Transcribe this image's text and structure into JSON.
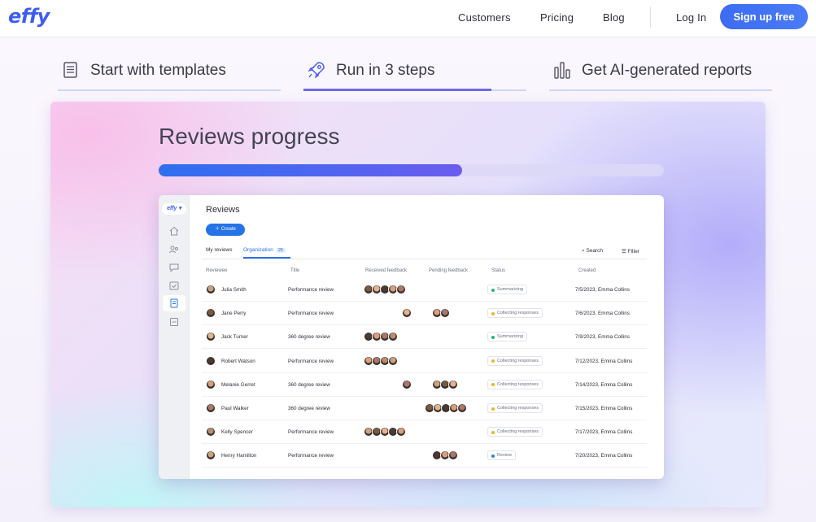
{
  "nav": {
    "logo": "effy",
    "links": [
      "Customers",
      "Pricing",
      "Blog"
    ],
    "login": "Log In",
    "signup": "Sign up free"
  },
  "feature_tabs": [
    {
      "label": "Start with templates",
      "icon": "document-icon",
      "active": false
    },
    {
      "label": "Run in 3 steps",
      "icon": "rocket-icon",
      "active": true
    },
    {
      "label": "Get AI-generated reports",
      "icon": "bar-chart-icon",
      "active": false
    }
  ],
  "hero": {
    "title": "Reviews progress",
    "progress_percent": 60
  },
  "app": {
    "logo": "effy",
    "title": "Reviews",
    "create_label": "Create",
    "tabs": {
      "my_reviews": "My reviews",
      "organization": "Organization",
      "organization_count": "25"
    },
    "search_label": "Search",
    "filter_label": "Filter",
    "columns": [
      "Reviewee",
      "Title",
      "Received feedback",
      "Pending feedback",
      "Status",
      "Created"
    ],
    "status_colors": {
      "Summarizing": "#22b573",
      "Collecting responses": "#f5b21a",
      "Review": "#2b7fe8"
    },
    "rows": [
      {
        "name": "Julia Smith",
        "title": "Performance review",
        "received": 5,
        "pending": 0,
        "status": "Summarizing",
        "created": "7/5/2023, Emma Collins"
      },
      {
        "name": "Jane Perry",
        "title": "Performance review",
        "received": 1,
        "pending": 2,
        "status": "Collecting responses",
        "created": "7/6/2023, Emma Collins"
      },
      {
        "name": "Jack Turner",
        "title": "360 degree review",
        "received": 4,
        "pending": 0,
        "status": "Summarizing",
        "created": "7/9/2023, Emma Collins"
      },
      {
        "name": "Robert Watson",
        "title": "Performance review",
        "received": 4,
        "pending": 0,
        "status": "Collecting responses",
        "created": "7/12/2023, Emma Collins"
      },
      {
        "name": "Melanie Gerret",
        "title": "360 degree review",
        "received": 1,
        "pending": 3,
        "status": "Collecting responses",
        "created": "7/14/2023, Emma Collins"
      },
      {
        "name": "Paul Walker",
        "title": "360 degree review",
        "received": 0,
        "pending": 5,
        "status": "Collecting responses",
        "created": "7/15/2023, Emma Collins"
      },
      {
        "name": "Kelly Spencer",
        "title": "Performance review",
        "received": 5,
        "pending": 0,
        "status": "Collecting responses",
        "created": "7/17/2023, Emma Collins"
      },
      {
        "name": "Henry Hamilton",
        "title": "Performance review",
        "received": 0,
        "pending": 3,
        "status": "Review",
        "created": "7/20/2023, Emma Collins"
      }
    ]
  }
}
